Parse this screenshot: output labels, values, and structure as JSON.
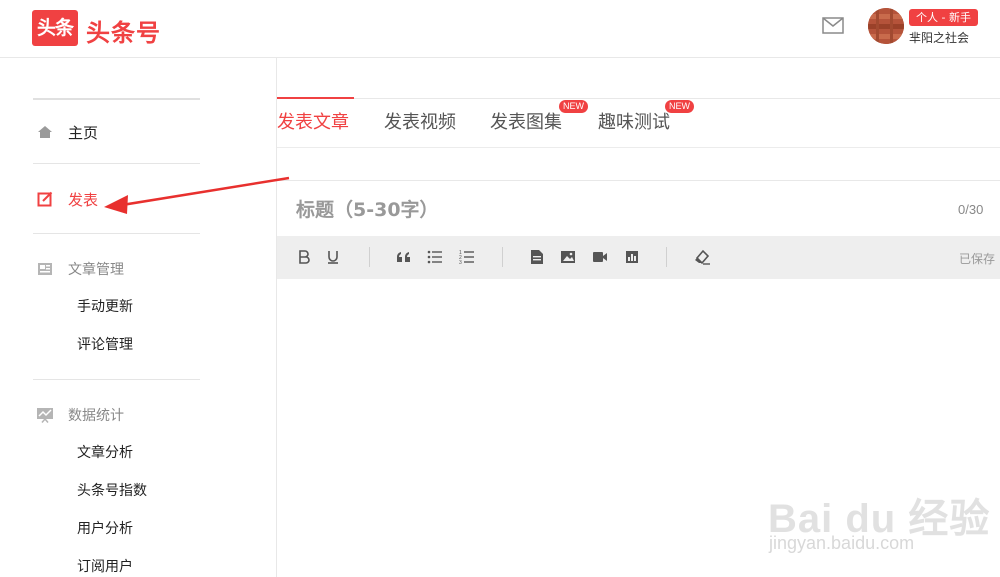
{
  "header": {
    "logo_mark": "头条",
    "logo_text": "头条号",
    "user_badge": "个人 - 新手",
    "user_name": "芈阳之社会"
  },
  "sidebar": {
    "home": "主页",
    "publish": "发表",
    "article_group": "文章管理",
    "article_items": [
      "手动更新",
      "评论管理"
    ],
    "stats_group": "数据统计",
    "stats_items": [
      "文章分析",
      "头条号指数",
      "用户分析",
      "订阅用户"
    ]
  },
  "tabs": [
    {
      "label": "发表文章",
      "badge": ""
    },
    {
      "label": "发表视频",
      "badge": ""
    },
    {
      "label": "发表图集",
      "badge": "NEW"
    },
    {
      "label": "趣味测试",
      "badge": "NEW"
    }
  ],
  "editor": {
    "title_placeholder": "标题（5-30字）",
    "char_count": "0/30",
    "saved_status": "已保存"
  },
  "watermark": {
    "main": "Bai du 经验",
    "sub": "jingyan.baidu.com"
  },
  "colors": {
    "accent": "#f04142"
  }
}
